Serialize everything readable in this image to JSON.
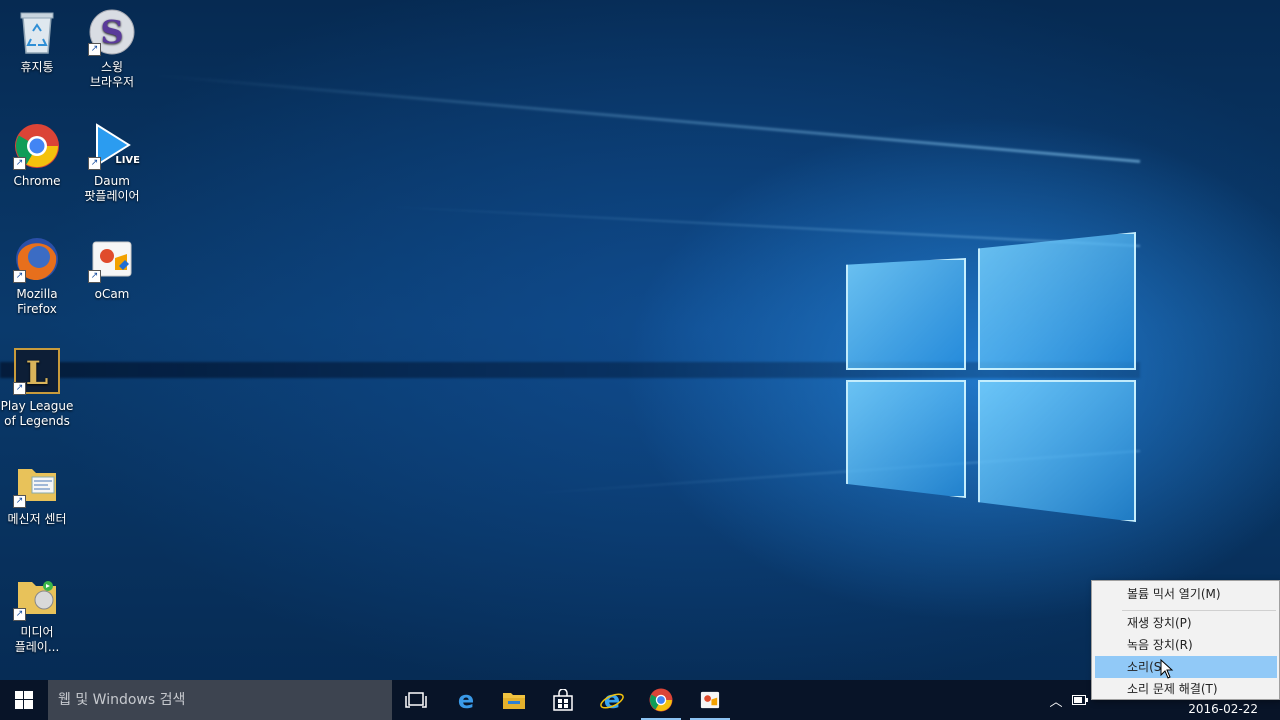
{
  "desktop_icons": [
    {
      "label": "휴지통",
      "icon": "recycle-bin-icon"
    },
    {
      "label": "스윙\n브라우저",
      "icon": "swing-browser-icon"
    },
    {
      "label": "Chrome",
      "icon": "chrome-icon"
    },
    {
      "label": "Daum\n팟플레이어",
      "icon": "daum-potplayer-icon"
    },
    {
      "label": "Mozilla\nFirefox",
      "icon": "firefox-icon"
    },
    {
      "label": "oCam",
      "icon": "ocam-icon"
    },
    {
      "label": "Play League\nof Legends",
      "icon": "league-of-legends-icon"
    },
    {
      "label": "메신저 센터",
      "icon": "messenger-center-folder-icon"
    },
    {
      "label": "미디어\n플레이...",
      "icon": "media-player-folder-icon"
    }
  ],
  "potplayer_badge": "LIVE",
  "taskbar": {
    "search_placeholder": "웹 및 Windows 검색",
    "pinned": [
      "task-view-icon",
      "edge-icon",
      "file-explorer-icon",
      "store-icon",
      "internet-explorer-icon",
      "chrome-icon",
      "ocam-icon"
    ],
    "clock_date": "2016-02-22"
  },
  "context_menu": {
    "items": [
      {
        "label": "볼륨 믹서 열기(M)"
      },
      {
        "label": "재생 장치(P)"
      },
      {
        "label": "녹음 장치(R)"
      },
      {
        "label": "소리(S)",
        "highlighted": true
      },
      {
        "label": "소리 문제 해결(T)"
      }
    ]
  },
  "colors": {
    "taskbar": "#08142a",
    "search_box": "#3d4450",
    "menu_highlight": "#91c9f7",
    "accent": "#1e90e0"
  }
}
